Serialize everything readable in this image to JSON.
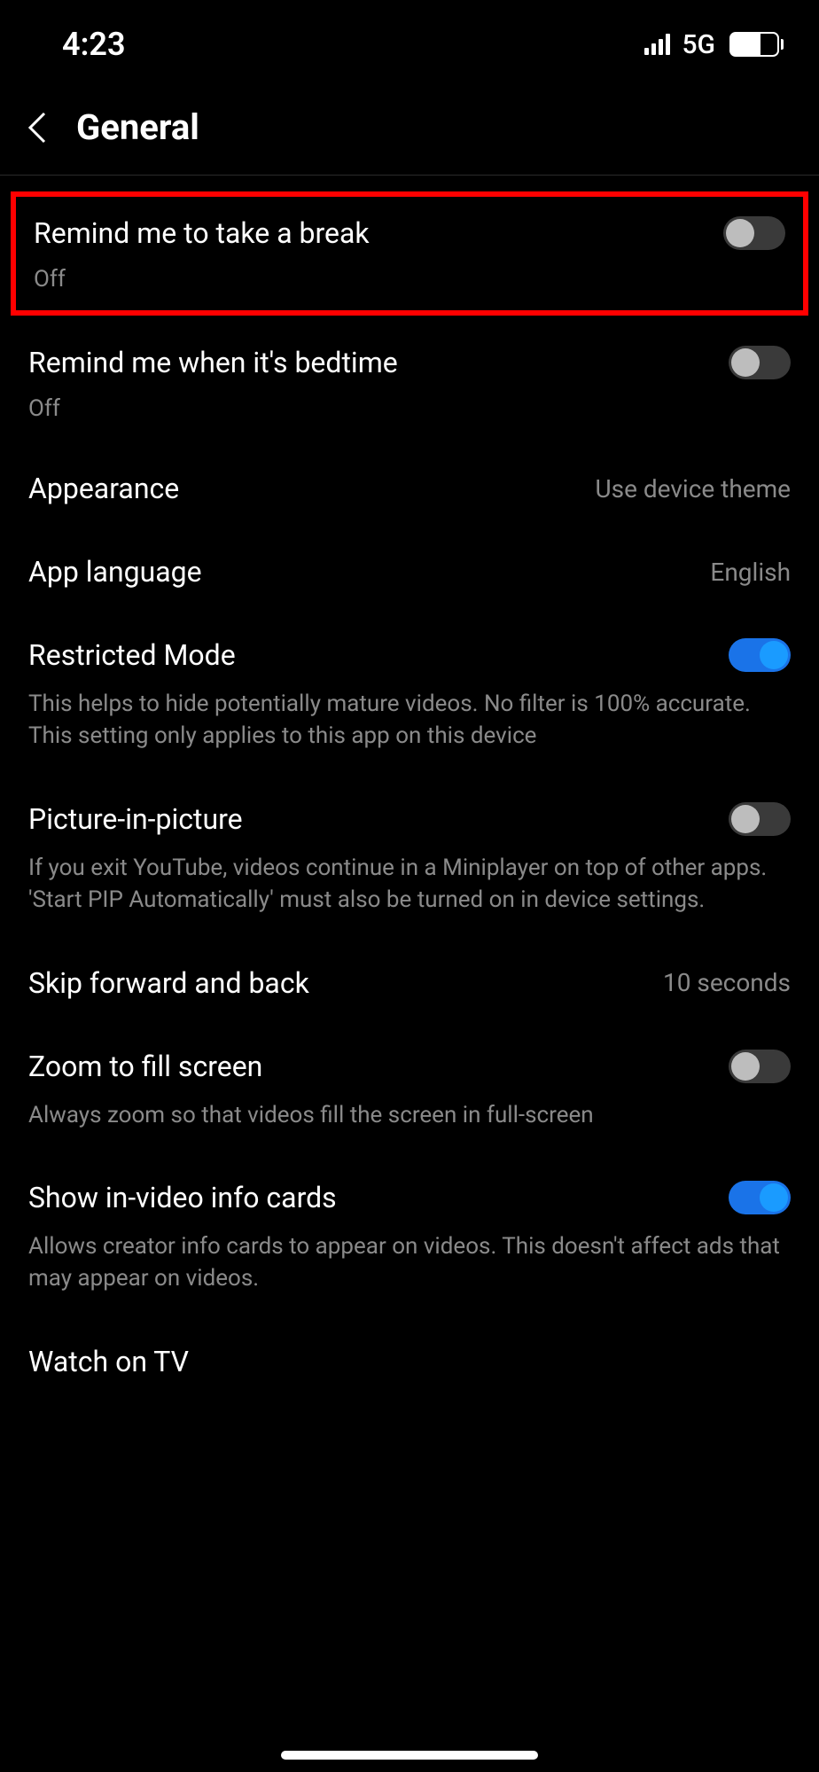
{
  "status": {
    "time": "4:23",
    "network": "5G",
    "battery": "63"
  },
  "header": {
    "title": "General"
  },
  "settings": {
    "break": {
      "title": "Remind me to take a break",
      "sub": "Off"
    },
    "bedtime": {
      "title": "Remind me when it's bedtime",
      "sub": "Off"
    },
    "appearance": {
      "title": "Appearance",
      "value": "Use device theme"
    },
    "language": {
      "title": "App language",
      "value": "English"
    },
    "restricted": {
      "title": "Restricted Mode",
      "desc": "This helps to hide potentially mature videos. No filter is 100% accurate. This setting only applies to this app on this device"
    },
    "pip": {
      "title": "Picture-in-picture",
      "desc": "If you exit YouTube, videos continue in a Miniplayer on top of other apps. 'Start PIP Automatically' must also be turned on in device settings."
    },
    "skip": {
      "title": "Skip forward and back",
      "value": "10 seconds"
    },
    "zoom": {
      "title": "Zoom to fill screen",
      "desc": "Always zoom so that videos fill the screen in full-screen"
    },
    "infocards": {
      "title": "Show in-video info cards",
      "desc": "Allows creator info cards to appear on videos. This doesn't affect ads that may appear on videos."
    },
    "watchtv": {
      "title": "Watch on TV"
    }
  }
}
